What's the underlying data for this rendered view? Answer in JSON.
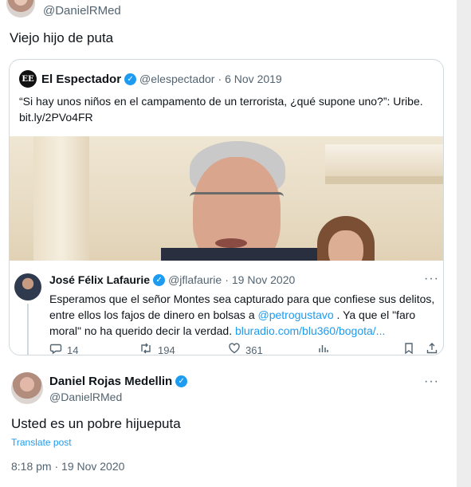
{
  "top_tweet": {
    "handle": "@DanielRMed",
    "text": "Viejo hijo de puta"
  },
  "quoted_tweet": {
    "logo_text": "EE",
    "name": "El Espectador",
    "handle": "@elespectador",
    "separator": "·",
    "date": "6 Nov 2019",
    "text": "“Si hay unos niños en el campamento de un terrorista, ¿qué supone uno?”: Uribe. bit.ly/2PVo4FR"
  },
  "reply_tweet": {
    "name": "José Félix Lafaurie",
    "handle": "@jflafaurie",
    "separator": "·",
    "date": "19 Nov 2020",
    "more": "···",
    "text_part1": "Esperamos que el señor Montes sea capturado para que confiese sus delitos, entre ellos los fajos de dinero en bolsas a ",
    "mention": "@petrogustavo",
    "text_part2": " . Ya que el \"faro moral\" no ha querido decir la verdad. ",
    "link": "bluradio.com/blu360/bogota/...",
    "replies": "14",
    "retweets": "194",
    "likes": "361"
  },
  "main_tweet": {
    "name": "Daniel Rojas Medellin",
    "handle": "@DanielRMed",
    "more": "···",
    "text": "Usted es un pobre hijueputa",
    "translate_label": "Translate post",
    "timestamp": "8:18 pm · 19 Nov 2020"
  },
  "icons": {
    "verified": "verified-badge-icon",
    "reply": "reply-icon",
    "retweet": "retweet-icon",
    "like": "heart-icon",
    "views": "views-icon",
    "bookmark": "bookmark-icon",
    "share": "share-icon"
  },
  "colors": {
    "accent": "#1d9bf0",
    "muted": "#536471",
    "text": "#0f1419",
    "border": "#cfd9de"
  }
}
